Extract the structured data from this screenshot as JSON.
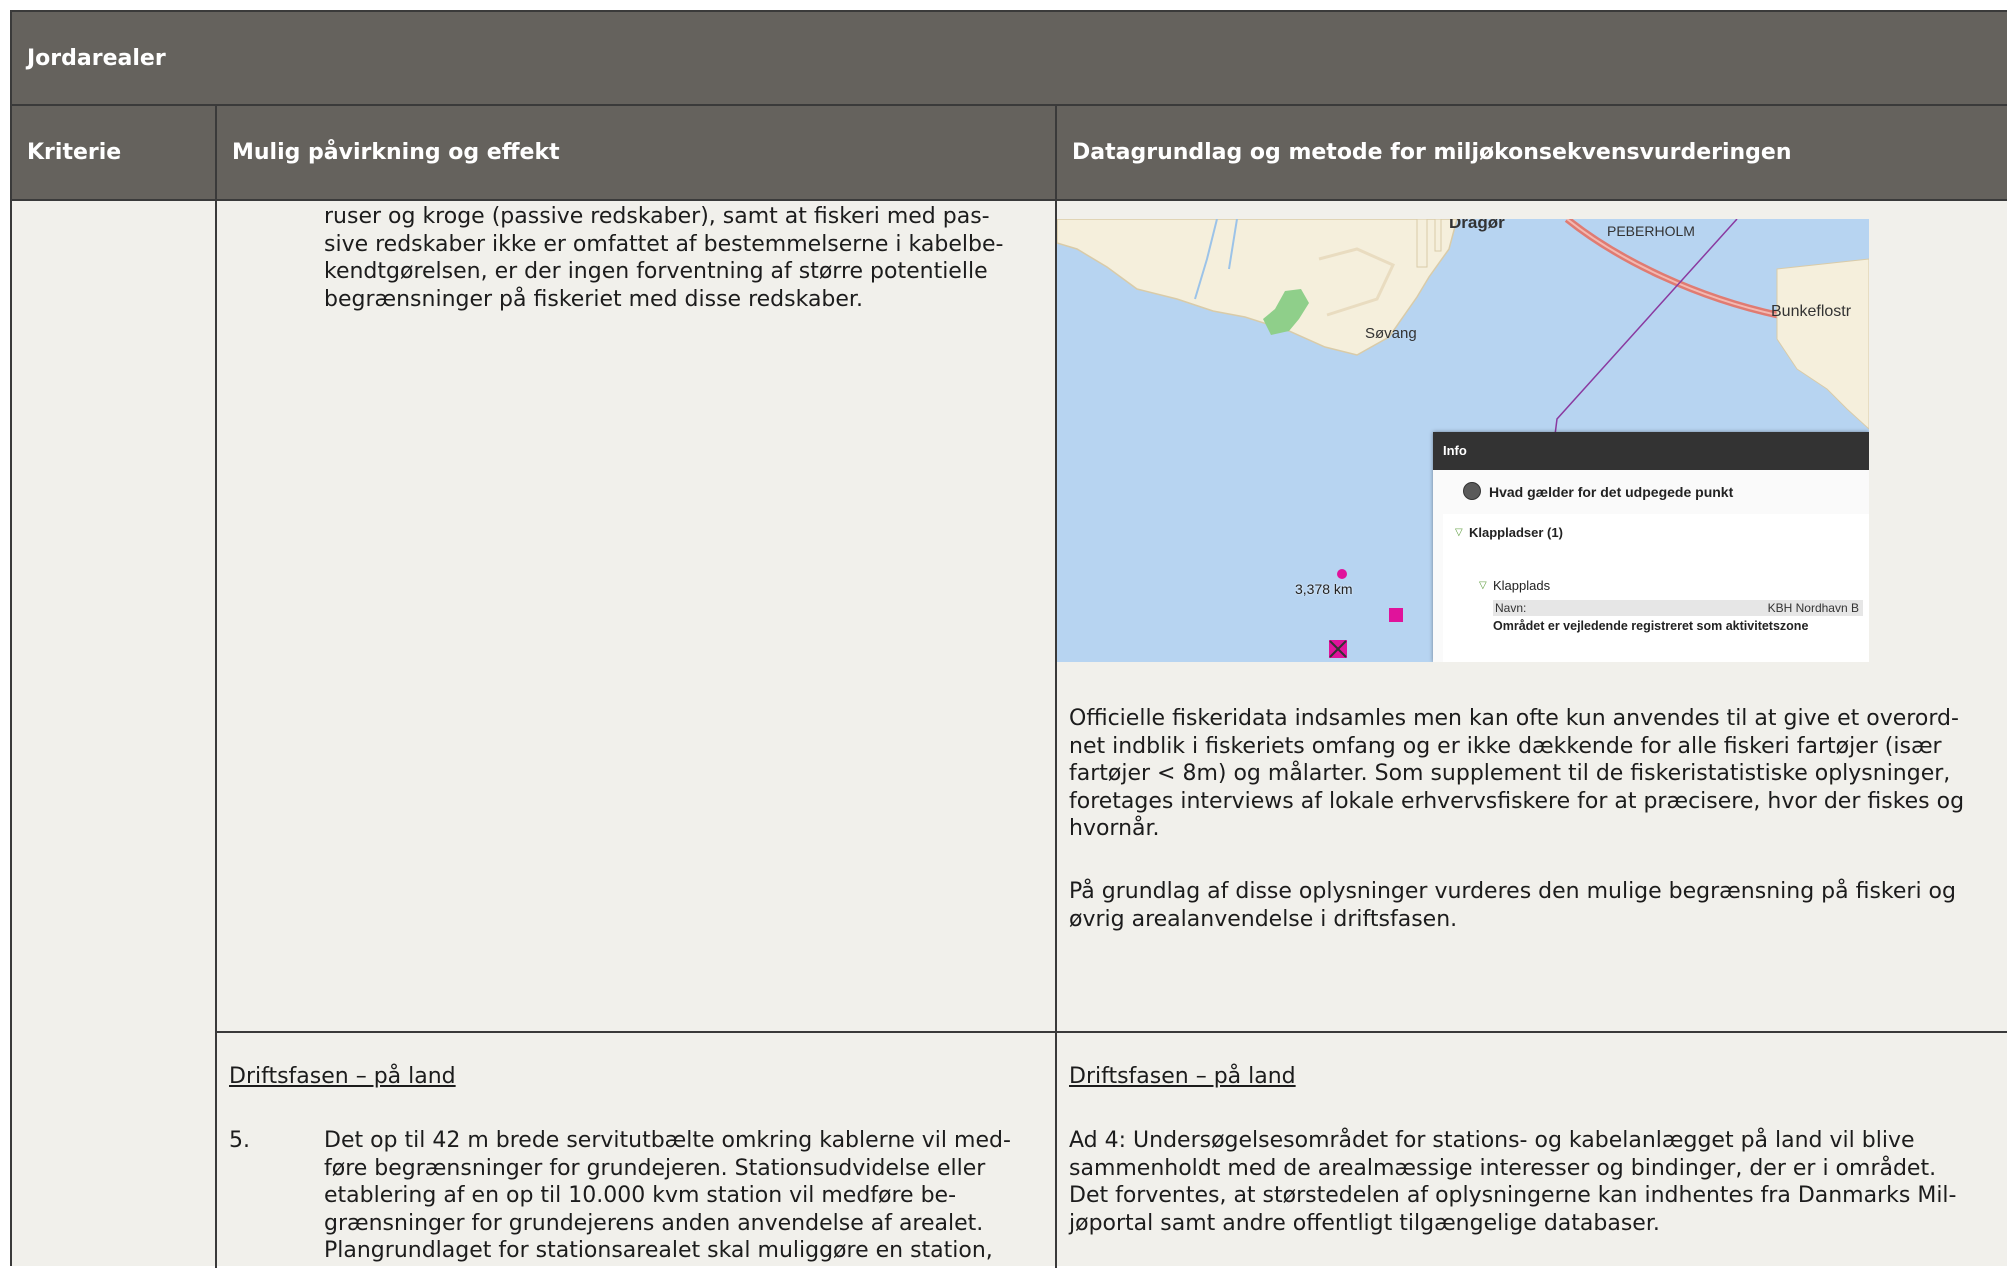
{
  "table": {
    "title": "Jordarealer",
    "headers": {
      "criterion": "Kriterie",
      "impact": "Mulig påvirkning og effekt",
      "method": "Datagrundlag og metode for miljøkonsekvensvurderingen"
    }
  },
  "row1": {
    "impact_lines": [
      "ruser og kroge (passive redskaber), samt at fiskeri med pas-",
      "sive redskaber ikke er omfattet af bestemmelserne i kabelbe-",
      "kendtgørelsen, er der ingen forventning af større potentielle",
      "begrænsninger på fiskeriet med disse redskaber."
    ],
    "method_para1_lines": [
      "Officielle fiskeridata indsamles men kan ofte kun anvendes til at give et overord-",
      "net indblik i fiskeriets omfang og er ikke dækkende for alle fiskeri fartøjer (især",
      "fartøjer < 8m) og målarter. Som supplement til de fiskeristatistiske oplysninger,",
      "foretages interviews af lokale erhvervsfiskere for at præcisere, hvor der fiskes og",
      "hvornår."
    ],
    "method_para2_lines": [
      "På grundlag af disse oplysninger vurderes den mulige begrænsning på fiskeri og",
      "øvrig arealanvendelse i driftsfasen."
    ]
  },
  "map": {
    "labels": {
      "dragor": "Dragør",
      "peberholm": "PEBERHOLM",
      "sovang": "Søvang",
      "bunkeflo": "Bunkeflostr",
      "distance": "3,378 km"
    },
    "info_panel": {
      "title": "Info",
      "question": "Hvad gælder for det udpegede punkt",
      "group": "Klappladser (1)",
      "subgroup": "Klapplads",
      "name_key": "Navn:",
      "name_value": "KBH Nordhavn B",
      "note": "Området er vejledende registreret som aktivitetszone"
    },
    "colors": {
      "sea": "#b7d4f1",
      "land": "#f5efdc",
      "marker": "#e0139b",
      "bridge": "#e07b72"
    }
  },
  "row2": {
    "impact_heading": "Driftsfasen – på land",
    "item_number": "5.",
    "impact_lines": [
      "Det op til 42 m brede servitutbælte omkring kablerne vil med-",
      "føre begrænsninger for grundejeren. Stationsudvidelse eller",
      "etablering af en op til 10.000 kvm station vil medføre be-",
      "grænsninger for grundejerens anden anvendelse af arealet.",
      "Plangrundlaget for stationsarealet skal muliggøre en station,"
    ],
    "method_heading": "Driftsfasen – på land",
    "method_lines": [
      "Ad 4: Undersøgelsesområdet for stations- og kabelanlægget på land vil blive",
      "sammenholdt med de arealmæssige interesser og bindinger, der er i området.",
      "Det forventes, at størstedelen af oplysningerne kan indhentes fra Danmarks Mil-",
      "jøportal samt andre offentligt tilgængelige databaser."
    ]
  }
}
